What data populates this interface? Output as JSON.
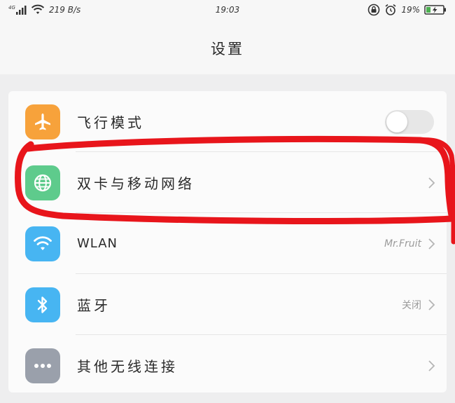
{
  "status_bar": {
    "speed": "219 B/s",
    "time": "19:03",
    "battery_percent": "19%",
    "signal_label": "4G"
  },
  "header": {
    "title": "设置"
  },
  "settings": {
    "items": [
      {
        "label": "飞行模式",
        "icon": "airplane-icon",
        "icon_color": "#f7a23b",
        "control": "toggle",
        "toggle_on": false
      },
      {
        "label": "双卡与移动网络",
        "icon": "globe-icon",
        "icon_color": "#5ecb8c",
        "control": "chevron",
        "value": ""
      },
      {
        "label": "WLAN",
        "icon": "wifi-icon",
        "icon_color": "#47b5f2",
        "control": "chevron",
        "value": "Mr.Fruit"
      },
      {
        "label": "蓝牙",
        "icon": "bluetooth-icon",
        "icon_color": "#47b5f2",
        "control": "chevron",
        "value": "关闭"
      },
      {
        "label": "其他无线连接",
        "icon": "more-icon",
        "icon_color": "#9aa0ab",
        "control": "chevron",
        "value": ""
      }
    ]
  },
  "annotation": {
    "color": "#e8151b"
  }
}
